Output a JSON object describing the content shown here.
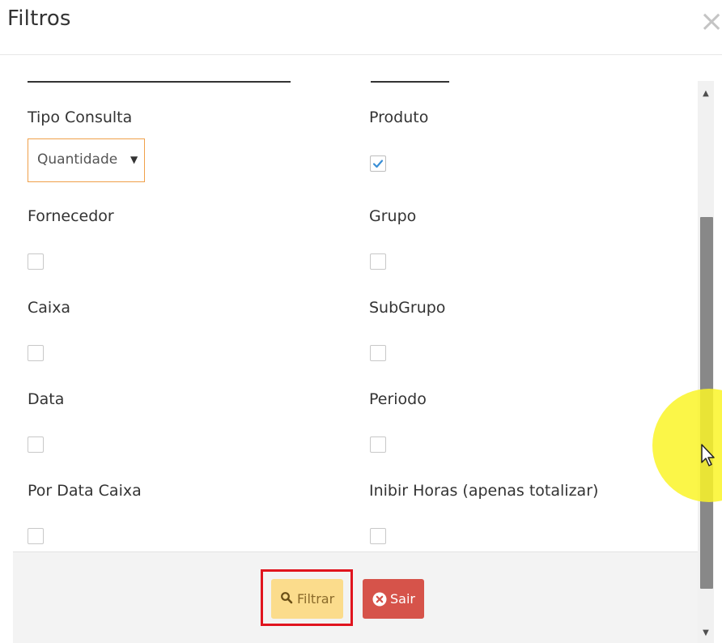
{
  "dialog": {
    "title": "Filtros",
    "close_glyph": "×"
  },
  "filters": {
    "tipo_consulta": {
      "label": "Tipo Consulta",
      "selected": "Quantidade"
    },
    "produto": {
      "label": "Produto",
      "checked": true
    },
    "fornecedor": {
      "label": "Fornecedor",
      "checked": false
    },
    "grupo": {
      "label": "Grupo",
      "checked": false
    },
    "caixa": {
      "label": "Caixa",
      "checked": false
    },
    "subgrupo": {
      "label": "SubGrupo",
      "checked": false
    },
    "data": {
      "label": "Data",
      "checked": false
    },
    "periodo": {
      "label": "Periodo",
      "checked": false
    },
    "por_data_caixa": {
      "label": "Por Data Caixa",
      "checked": false
    },
    "inibir_horas": {
      "label": "Inibir Horas (apenas totalizar)",
      "checked": false
    }
  },
  "footer": {
    "filtrar_label": "Filtrar",
    "filtrar_icon": "search-icon",
    "sair_label": "Sair",
    "sair_icon": "close-circle-icon"
  },
  "colors": {
    "accent_select_border": "#f0a04a",
    "checkmark": "#3a8fd6",
    "filtrar_bg": "#fbdc8c",
    "sair_bg": "#d6534a",
    "highlight": "#e0141e",
    "cursor_halo": "#faf528"
  }
}
